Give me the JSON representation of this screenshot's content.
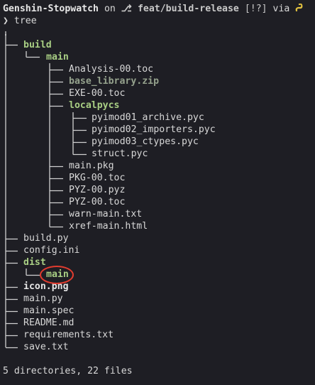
{
  "prompt": {
    "directory": "Genshin-Stopwatch",
    "on_word": "on",
    "branch_icon": "git-branch-icon",
    "branch": "feat/build-release",
    "status": "[!?]",
    "via_word": "via",
    "lang_icon": "python-icon",
    "chevron": "❯",
    "command": "tree"
  },
  "tree": {
    "root": ".",
    "build": "build",
    "build_main": "main",
    "analysis": "Analysis-00.toc",
    "base_library": "base_library.zip",
    "exe": "EXE-00.toc",
    "localpycs": "localpycs",
    "pyimod01": "pyimod01_archive.pyc",
    "pyimod02": "pyimod02_importers.pyc",
    "pyimod03": "pyimod03_ctypes.pyc",
    "struct": "struct.pyc",
    "main_pkg": "main.pkg",
    "pkg": "PKG-00.toc",
    "pyz_pyz": "PYZ-00.pyz",
    "pyz_toc": "PYZ-00.toc",
    "warn": "warn-main.txt",
    "xref": "xref-main.html",
    "build_py": "build.py",
    "config": "config.ini",
    "dist": "dist",
    "dist_main": "main",
    "icon": "icon.png",
    "main_py": "main.py",
    "main_spec": "main.spec",
    "readme": "README.md",
    "requirements": "requirements.txt",
    "save": "save.txt"
  },
  "summary": "5 directories, 22 files",
  "colors": {
    "background": "#1e1e24",
    "directory": "#a9cf84",
    "highlight_circle": "#e23c2f"
  }
}
